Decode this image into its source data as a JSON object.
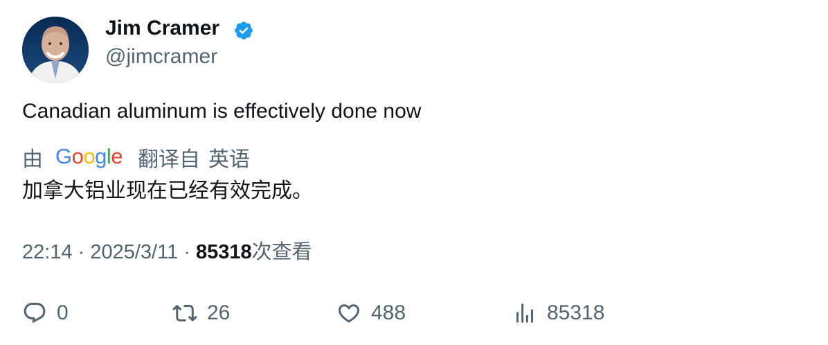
{
  "author": {
    "display_name": "Jim Cramer",
    "handle": "@jimcramer",
    "verified": true
  },
  "tweet": {
    "text": "Canadian aluminum is effectively done now"
  },
  "translation": {
    "by_label": "由",
    "provider": "Google",
    "translated_from_label": "翻译自",
    "source_language": "英语",
    "text": "加拿大铝业现在已经有效完成。"
  },
  "meta": {
    "time": "22:14",
    "separator": " · ",
    "date": "2025/3/11",
    "views_count": "85318",
    "views_label": "次查看"
  },
  "actions": {
    "replies": "0",
    "retweets": "26",
    "likes": "488",
    "views": "85318"
  },
  "colors": {
    "text_primary": "#0f1419",
    "text_secondary": "#536471",
    "verified_blue": "#1d9bf0",
    "google_blue": "#4285F4",
    "google_red": "#EA4335",
    "google_yellow": "#FBBC05",
    "google_green": "#34A853"
  },
  "icons": {
    "reply": "reply-icon",
    "retweet": "retweet-icon",
    "like": "heart-icon",
    "views": "analytics-icon",
    "verified": "verified-badge-icon"
  }
}
